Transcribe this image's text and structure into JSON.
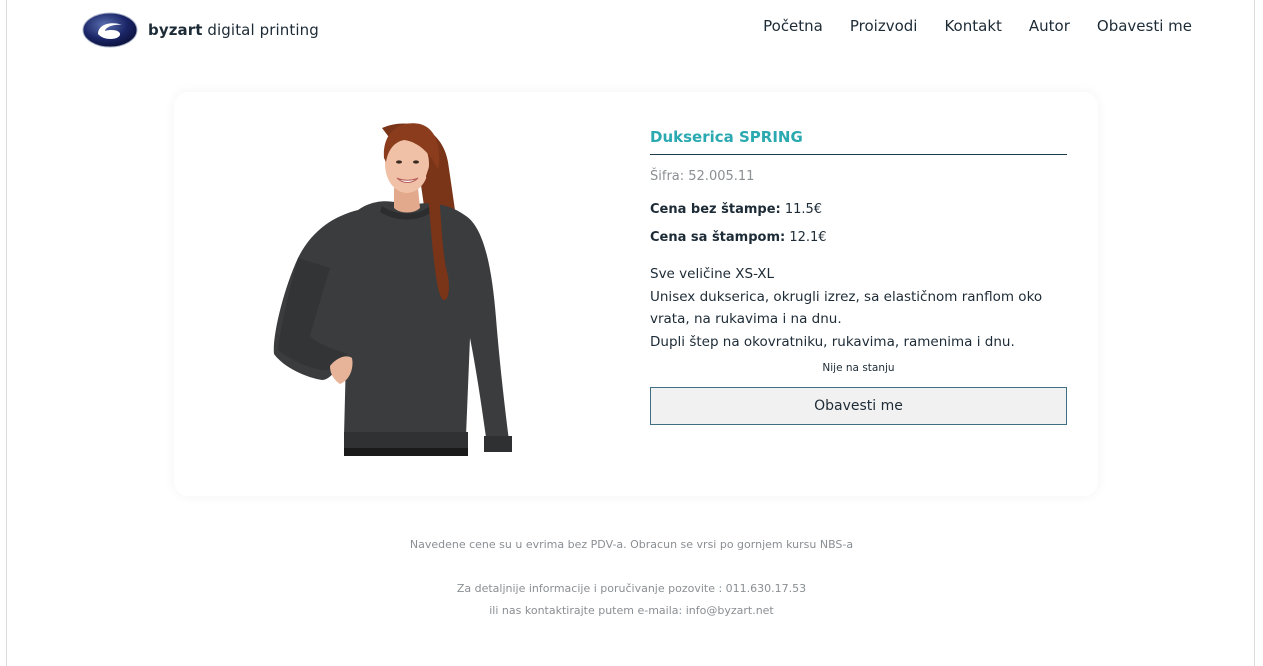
{
  "brand": {
    "name_bold": "byzart",
    "name_rest": " digital printing"
  },
  "nav": {
    "items": [
      {
        "label": "Početna"
      },
      {
        "label": "Proizvodi"
      },
      {
        "label": "Kontakt"
      },
      {
        "label": "Autor"
      },
      {
        "label": "Obavesti me"
      }
    ]
  },
  "product": {
    "title": "Dukserica SPRING",
    "code": "Šifra: 52.005.11",
    "price_no_print_label": "Cena bez štampe:",
    "price_no_print_value": " 11.5€",
    "price_print_label": "Cena sa štampom:",
    "price_print_value": " 12.1€",
    "description": [
      "Sve veličine XS-XL",
      "Unisex dukserica, okrugli izrez, sa elastičnom ranflom oko vrata, na rukavima i na dnu.",
      "Dupli štep na okovratniku, rukavima, ramenima i dnu."
    ],
    "stock_status": "Nije na stanju",
    "notify_button": "Obavesti me"
  },
  "footer": {
    "line1": "Navedene cene su u evrima bez PDV-a. Obracun se vrsi po gornjem kursu NBS-a",
    "line2": "Za detaljnije informacije i poručivanje pozovite : 011.630.17.53",
    "line3": "ili nas kontaktirajte putem e-maila: info@byzart.net"
  },
  "colors": {
    "accent": "#2aa9b0",
    "text": "#1d2b36",
    "muted": "#8a8f93",
    "button_border": "#3f6d82",
    "button_bg": "#f1f1f1"
  },
  "icons": {
    "logo": "byzart-logo-icon"
  }
}
